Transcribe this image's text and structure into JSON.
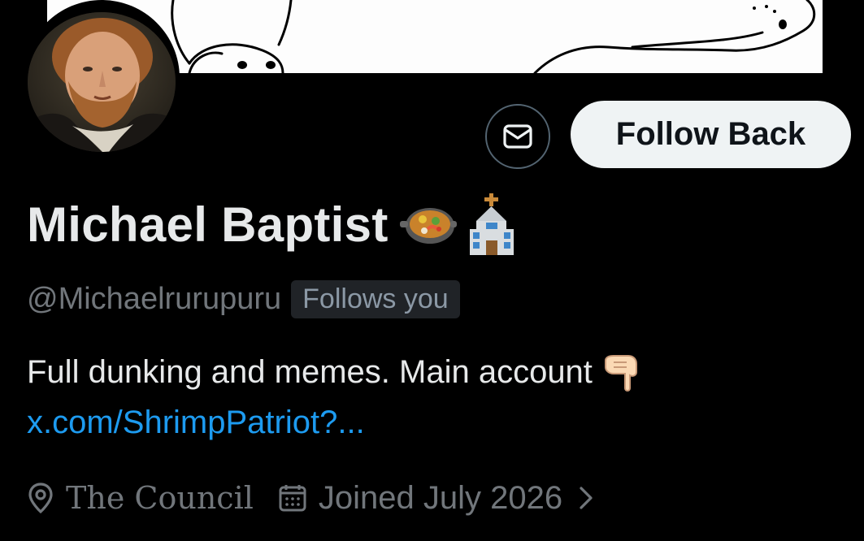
{
  "profile": {
    "name": "Michael Baptist",
    "name_emojis": [
      "paella-icon",
      "church-icon"
    ],
    "handle": "@Michaelrurupuru",
    "follows_you_badge": "Follows you",
    "bio_text": "Full dunking and memes. Main account",
    "bio_emoji": "pointing-down-hand-icon",
    "bio_link": "x.com/ShrimpPatriot?...",
    "location": "The Council",
    "joined": "Joined July 2026"
  },
  "actions": {
    "message_icon": "envelope-icon",
    "follow_label": "Follow Back"
  },
  "colors": {
    "background": "#000000",
    "text_primary": "#e7e9ea",
    "text_secondary": "#71767b",
    "link": "#1d9bf0",
    "button_bg": "#eff3f4",
    "button_text": "#0f1419"
  }
}
